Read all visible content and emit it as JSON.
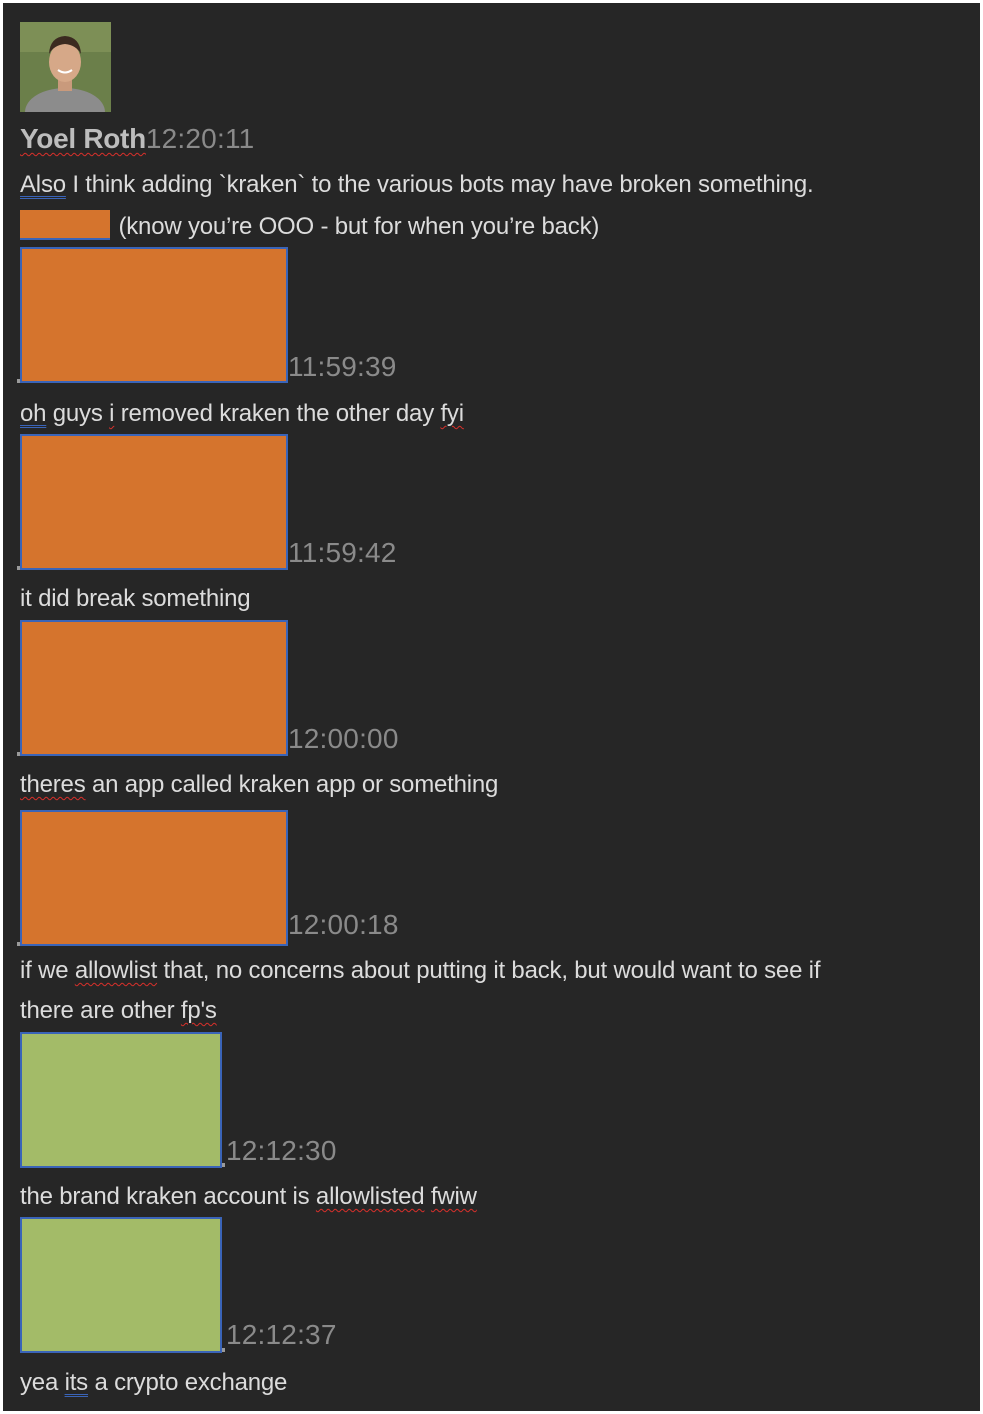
{
  "sender": {
    "name": "Yoel Roth",
    "timestamp": "12:20:11"
  },
  "messages": [
    {
      "line1_lead": "Also",
      "line1_rest": " I think adding `kraken` to the various bots may have broken something.",
      "line2_text": " (know you’re OOO - but for when you’re back)"
    },
    {
      "timestamp": "11:59:39",
      "text_a": "oh",
      "text_b": " guys ",
      "text_c": "i",
      "text_d": " removed kraken the other day ",
      "text_e": "fyi"
    },
    {
      "timestamp": "11:59:42",
      "text": "it did break something"
    },
    {
      "timestamp": "12:00:00",
      "text_a": "theres",
      "text_b": " an app called kraken app or something"
    },
    {
      "timestamp": "12:00:18",
      "line1_a": "if we ",
      "line1_b": "allowlist",
      "line1_c": " that, no concerns about putting it back, but would want to see if",
      "line2_a": "there are other ",
      "line2_b": "fp's"
    },
    {
      "timestamp": "12:12:30",
      "text_a": "the brand kraken account is ",
      "text_b": "allowlisted",
      "text_c": " ",
      "text_d": "fwiw"
    },
    {
      "timestamp": "12:12:37",
      "text_a": "yea ",
      "text_b": "its",
      "text_c": " a crypto exchange"
    }
  ],
  "redaction_colors": {
    "orange": "#d5742d",
    "green": "#a3bb68"
  }
}
